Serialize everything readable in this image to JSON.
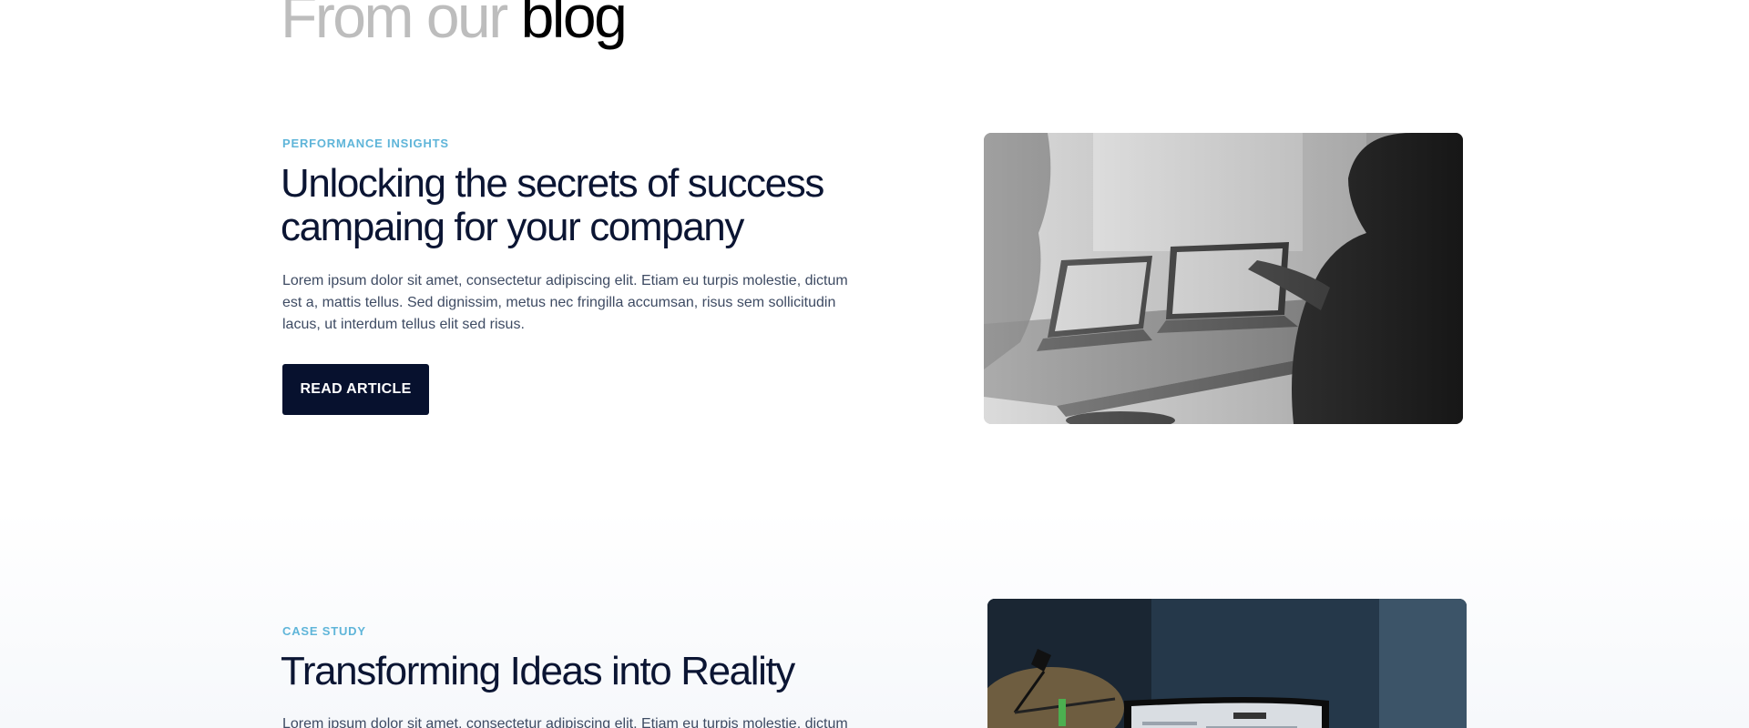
{
  "heading": {
    "muted": "From our",
    "strong": "blog"
  },
  "posts": [
    {
      "category": "PERFORMANCE INSIGHTS",
      "title": "Unlocking the secrets of success campaing for your company",
      "excerpt": "Lorem ipsum dolor sit amet, consectetur adipiscing elit. Etiam eu turpis molestie, dictum est a, mattis tellus. Sed dignissim, metus nec fringilla accumsan, risus sem sollicitudin lacus, ut interdum tellus elit sed risus.",
      "button_label": "READ ARTICLE",
      "image": "office-laptops-photo"
    },
    {
      "category": "CASE STUDY",
      "title": "Transforming Ideas into Reality",
      "excerpt": "Lorem ipsum dolor sit amet, consectetur adipiscing elit. Etiam eu turpis molestie, dictum",
      "image": "desk-monitor-photo"
    }
  ],
  "colors": {
    "accent": "#5fb5d9",
    "button_bg": "#07112e",
    "title": "#0b1533",
    "body_text": "#3e4b63",
    "heading_muted": "#bdbdbd"
  }
}
